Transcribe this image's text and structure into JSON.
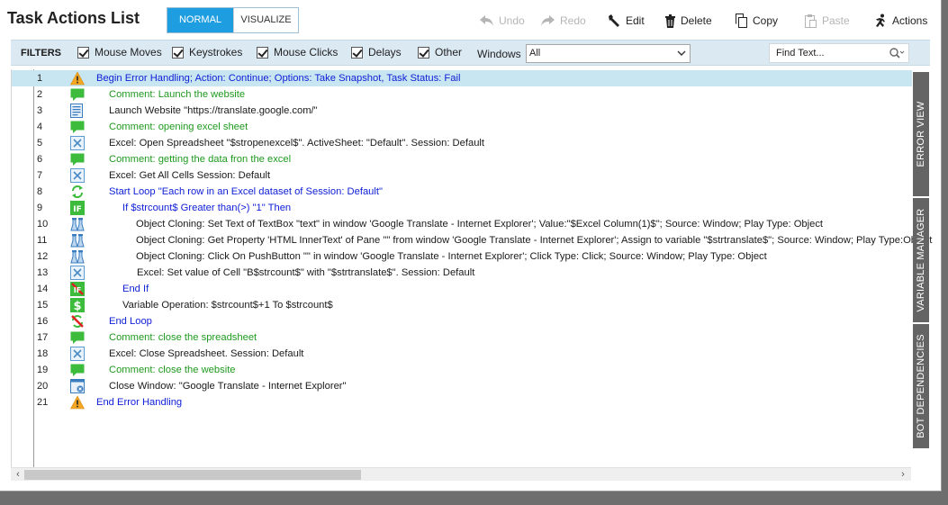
{
  "title": "Task Actions List",
  "modes": {
    "normal": "NORMAL",
    "visualize": "VISUALIZE"
  },
  "toolbar": {
    "undo": "Undo",
    "redo": "Redo",
    "edit": "Edit",
    "delete": "Delete",
    "copy": "Copy",
    "paste": "Paste",
    "actions": "Actions"
  },
  "filters": {
    "label": "FILTERS",
    "mouse_moves": "Mouse Moves",
    "keystrokes": "Keystrokes",
    "mouse_clicks": "Mouse Clicks",
    "delays": "Delays",
    "other": "Other",
    "windows_label": "Windows",
    "windows_value": "All",
    "find_placeholder": "Find Text..."
  },
  "rows": [
    {
      "num": "1",
      "text": "Begin Error Handling; Action: Continue; Options: Take Snapshot,  Task Status: Fail",
      "icon": "warning-icon",
      "color": "blue"
    },
    {
      "num": "2",
      "text": "Comment: Launch the website",
      "icon": "comment-icon",
      "color": "green"
    },
    {
      "num": "3",
      "text": "Launch Website \"https://translate.google.com/\"",
      "icon": "website-icon",
      "color": "black"
    },
    {
      "num": "4",
      "text": "Comment: opening excel sheet",
      "icon": "comment-icon",
      "color": "green"
    },
    {
      "num": "5",
      "text": "Excel: Open Spreadsheet \"$stropenexcel$\". ActiveSheet: \"Default\". Session: Default",
      "icon": "excel-icon",
      "color": "black"
    },
    {
      "num": "6",
      "text": "Comment: getting the data fron the excel",
      "icon": "comment-icon",
      "color": "green"
    },
    {
      "num": "7",
      "text": "Excel: Get All Cells Session: Default",
      "icon": "excel-icon",
      "color": "black"
    },
    {
      "num": "8",
      "text": "Start Loop \"Each row in an Excel dataset of Session: Default\"",
      "icon": "loop-icon",
      "color": "blue"
    },
    {
      "num": "9",
      "text": "If $strcount$ Greater than(>) \"1\" Then",
      "icon": "if-icon",
      "color": "blue"
    },
    {
      "num": "10",
      "text": "Object Cloning: Set Text of TextBox \"text\" in window 'Google Translate - Internet Explorer'; Value:\"$Excel Column(1)$\"; Source: Window; Play Type: Object",
      "icon": "object-cloning-icon",
      "color": "black"
    },
    {
      "num": "11",
      "text": "Object Cloning: Get Property 'HTML InnerText' of Pane \"\" from window 'Google Translate - Internet Explorer'; Assign to variable \"$strtranslate$\"; Source: Window; Play Type:Object",
      "icon": "object-cloning-icon",
      "color": "black"
    },
    {
      "num": "12",
      "text": "Object Cloning: Click On PushButton \"\" in window 'Google Translate - Internet Explorer'; Click Type: Click; Source: Window; Play Type: Object",
      "icon": "object-cloning-icon",
      "color": "black"
    },
    {
      "num": "13",
      "text": "Excel: Set value of Cell \"B$strcount$\" with \"$strtranslate$\". Session: Default",
      "icon": "excel-icon",
      "color": "black"
    },
    {
      "num": "14",
      "text": "End If",
      "icon": "end-if-icon",
      "color": "blue"
    },
    {
      "num": "15",
      "text": "Variable Operation: $strcount$+1 To $strcount$",
      "icon": "variable-icon",
      "color": "black"
    },
    {
      "num": "16",
      "text": "End Loop",
      "icon": "end-loop-icon",
      "color": "blue"
    },
    {
      "num": "17",
      "text": "Comment: close the spreadsheet",
      "icon": "comment-icon",
      "color": "green"
    },
    {
      "num": "18",
      "text": "Excel: Close Spreadsheet. Session: Default",
      "icon": "excel-icon",
      "color": "black"
    },
    {
      "num": "19",
      "text": "Comment: close the website",
      "icon": "comment-icon",
      "color": "green"
    },
    {
      "num": "20",
      "text": "Close Window: \"Google Translate - Internet Explorer\"",
      "icon": "close-window-icon",
      "color": "black"
    },
    {
      "num": "21",
      "text": "End Error Handling",
      "icon": "warning-icon",
      "color": "blue"
    }
  ],
  "side_tabs": {
    "error_view": "ERROR VIEW",
    "variable_manager": "VARIABLE MANAGER",
    "bot_dependencies": "BOT DEPENDENCIES"
  },
  "colors": {
    "accent": "#1e9ee0",
    "filters_bg": "#dbe9f3",
    "selected_row": "#c8e6f2",
    "comment_text": "#1f9a1f",
    "keyword_text": "#1020d6",
    "side_tab_bg": "#646464"
  }
}
